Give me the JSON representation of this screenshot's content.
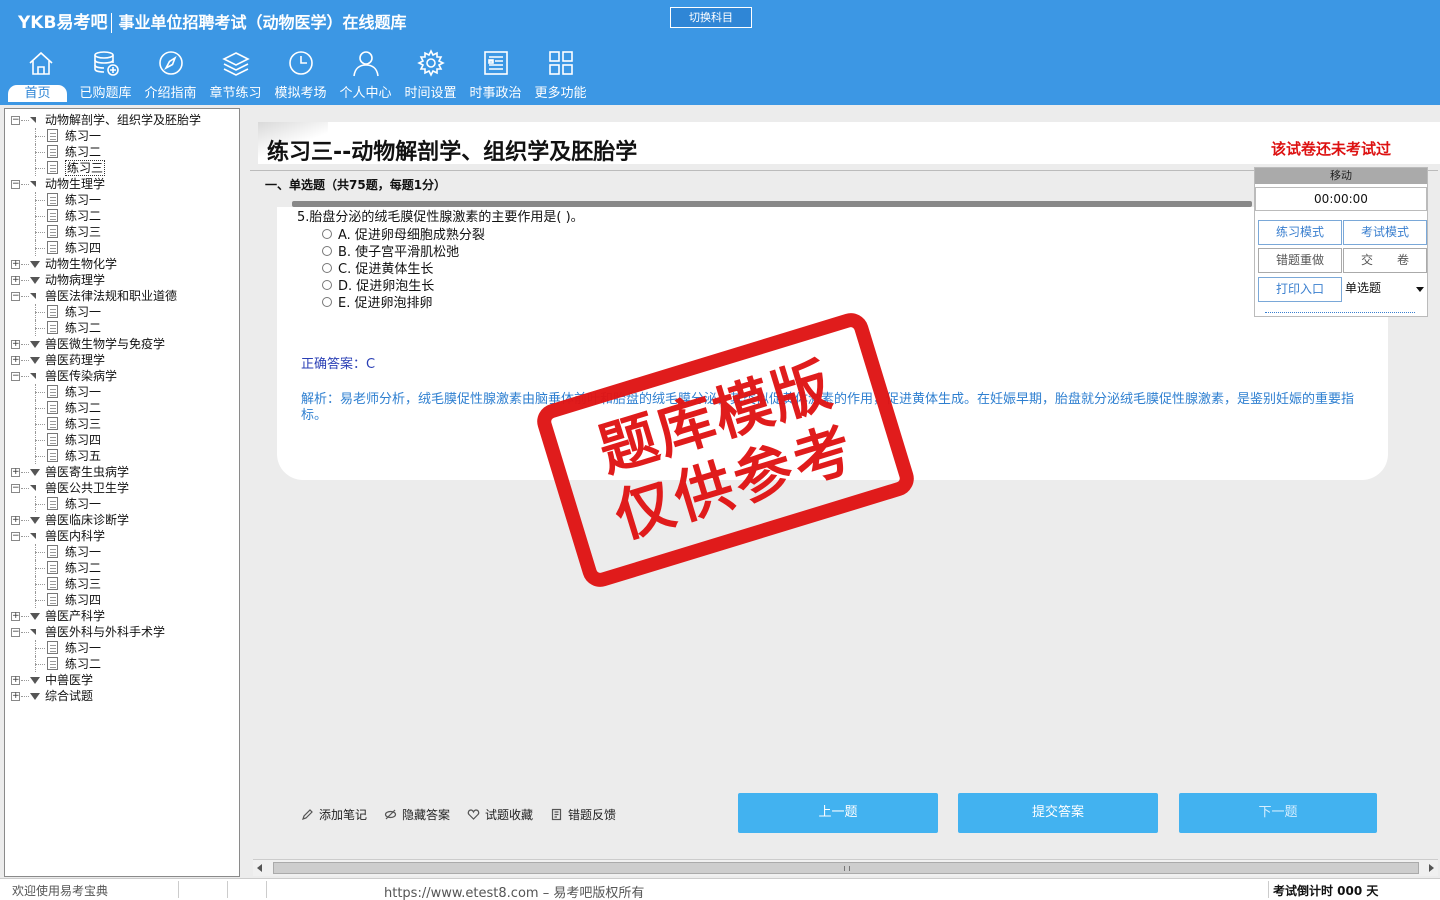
{
  "header": {
    "logo": "YKB易考吧",
    "title": "事业单位招聘考试（动物医学）在线题库",
    "switch_label": "切换科目"
  },
  "nav": {
    "items": [
      {
        "label": "首页",
        "icon": "home-icon"
      },
      {
        "label": "已购题库",
        "icon": "database-add-icon"
      },
      {
        "label": "介绍指南",
        "icon": "compass-icon"
      },
      {
        "label": "章节练习",
        "icon": "layers-icon"
      },
      {
        "label": "模拟考场",
        "icon": "clock-icon"
      },
      {
        "label": "个人中心",
        "icon": "user-icon"
      },
      {
        "label": "时间设置",
        "icon": "gear-icon"
      },
      {
        "label": "时事政治",
        "icon": "news-icon"
      },
      {
        "label": "更多功能",
        "icon": "grid-icon"
      }
    ],
    "active_index": 0
  },
  "tree": {
    "nodes": [
      {
        "label": "动物解剖学、组织学及胚胎学",
        "level": 0,
        "expanded": true
      },
      {
        "label": "练习一",
        "level": 1
      },
      {
        "label": "练习二",
        "level": 1
      },
      {
        "label": "练习三",
        "level": 1,
        "selected": true
      },
      {
        "label": "动物生理学",
        "level": 0,
        "expanded": true
      },
      {
        "label": "练习一",
        "level": 1
      },
      {
        "label": "练习二",
        "level": 1
      },
      {
        "label": "练习三",
        "level": 1
      },
      {
        "label": "练习四",
        "level": 1
      },
      {
        "label": "动物生物化学",
        "level": 0,
        "expanded": false
      },
      {
        "label": "动物病理学",
        "level": 0,
        "expanded": false
      },
      {
        "label": "兽医法律法规和职业道德",
        "level": 0,
        "expanded": true
      },
      {
        "label": "练习一",
        "level": 1
      },
      {
        "label": "练习二",
        "level": 1
      },
      {
        "label": "兽医微生物学与免疫学",
        "level": 0,
        "expanded": false
      },
      {
        "label": "兽医药理学",
        "level": 0,
        "expanded": false
      },
      {
        "label": "兽医传染病学",
        "level": 0,
        "expanded": true
      },
      {
        "label": "练习一",
        "level": 1
      },
      {
        "label": "练习二",
        "level": 1
      },
      {
        "label": "练习三",
        "level": 1
      },
      {
        "label": "练习四",
        "level": 1
      },
      {
        "label": "练习五",
        "level": 1
      },
      {
        "label": "兽医寄生虫病学",
        "level": 0,
        "expanded": false
      },
      {
        "label": "兽医公共卫生学",
        "level": 0,
        "expanded": true
      },
      {
        "label": "练习一",
        "level": 1
      },
      {
        "label": "兽医临床诊断学",
        "level": 0,
        "expanded": false
      },
      {
        "label": "兽医内科学",
        "level": 0,
        "expanded": true
      },
      {
        "label": "练习一",
        "level": 1
      },
      {
        "label": "练习二",
        "level": 1
      },
      {
        "label": "练习三",
        "level": 1
      },
      {
        "label": "练习四",
        "level": 1
      },
      {
        "label": "兽医产科学",
        "level": 0,
        "expanded": false
      },
      {
        "label": "兽医外科与外科手术学",
        "level": 0,
        "expanded": true
      },
      {
        "label": "练习一",
        "level": 1
      },
      {
        "label": "练习二",
        "level": 1
      },
      {
        "label": "中兽医学",
        "level": 0,
        "expanded": false
      },
      {
        "label": "综合试题",
        "level": 0,
        "expanded": false
      }
    ]
  },
  "exam": {
    "title": "练习三--动物解剖学、组织学及胚胎学",
    "status": "该试卷还未考试过",
    "section": "一、单选题（共75题，每题1分）",
    "question": "5.胎盘分泌的绒毛膜促性腺激素的主要作用是( )。",
    "options": [
      "A. 促进卵母细胞成熟分裂",
      "B. 使子宫平滑肌松弛",
      "C. 促进黄体生长",
      "D. 促进卵泡生长",
      "E. 促进卵泡排卵"
    ],
    "answer": "正确答案：C",
    "analysis": "解析：易老师分析，绒毛膜促性腺激素由脑垂体前叶和胎盘的绒毛膜分泌，其类似促黄体激素的作用，促进黄体生成。在妊娠早期，胎盘就分泌绒毛膜促性腺激素，是鉴别妊娠的重要指标。"
  },
  "stamp": {
    "line1": "题库模版",
    "line2": "仅供参考"
  },
  "control": {
    "move": "移动",
    "timer": "00:00:00",
    "practice_mode": "练习模式",
    "exam_mode": "考试模式",
    "redo_wrong": "错题重做",
    "submit_paper": "交　　卷",
    "print": "打印入口",
    "type_select": "单选题"
  },
  "tools": {
    "note": "添加笔记",
    "hide_answer": "隐藏答案",
    "favorite": "试题收藏",
    "feedback": "错题反馈"
  },
  "buttons": {
    "prev": "上一题",
    "submit": "提交答案",
    "next": "下一题"
  },
  "statusbar": {
    "welcome": "欢迎使用易考宝典",
    "copyright": "https://www.etest8.com – 易考吧版权所有",
    "countdown": "考试倒计时 000 天"
  },
  "colors": {
    "header": "#3c97e4",
    "button": "#42b2f0",
    "stamp": "#e01515",
    "warn": "#dd1111"
  }
}
